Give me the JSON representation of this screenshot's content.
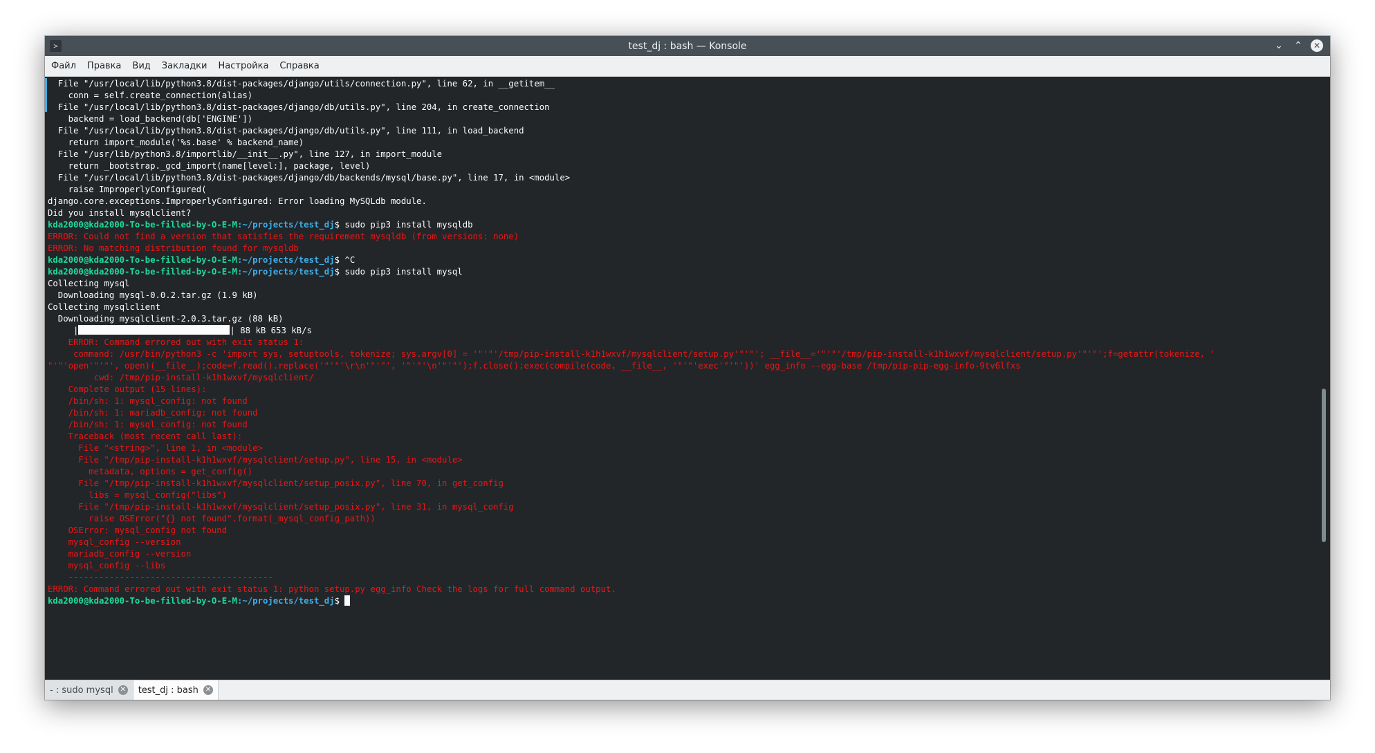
{
  "window": {
    "title": "test_dj : bash — Konsole",
    "app_icon": "terminal-icon",
    "controls": [
      "minimize-icon",
      "maximize-icon",
      "close-icon"
    ]
  },
  "menu": {
    "items": [
      "Файл",
      "Правка",
      "Вид",
      "Закладки",
      "Настройка",
      "Справка"
    ]
  },
  "terminal": {
    "prompt_user": "kda2000@kda2000-To-be-filled-by-O-E-M",
    "prompt_path": ":~/projects/test_dj",
    "lines": [
      {
        "text": "  File \"/usr/local/lib/python3.8/dist-packages/django/utils/connection.py\", line 62, in __getitem__",
        "type": "out"
      },
      {
        "text": "    conn = self.create_connection(alias)",
        "type": "out"
      },
      {
        "text": "  File \"/usr/local/lib/python3.8/dist-packages/django/db/utils.py\", line 204, in create_connection",
        "type": "out"
      },
      {
        "text": "    backend = load_backend(db['ENGINE'])",
        "type": "out"
      },
      {
        "text": "  File \"/usr/local/lib/python3.8/dist-packages/django/db/utils.py\", line 111, in load_backend",
        "type": "out"
      },
      {
        "text": "    return import_module('%s.base' % backend_name)",
        "type": "out"
      },
      {
        "text": "  File \"/usr/lib/python3.8/importlib/__init__.py\", line 127, in import_module",
        "type": "out"
      },
      {
        "text": "    return _bootstrap._gcd_import(name[level:], package, level)",
        "type": "out"
      },
      {
        "text": "  File \"/usr/local/lib/python3.8/dist-packages/django/db/backends/mysql/base.py\", line 17, in <module>",
        "type": "out"
      },
      {
        "text": "    raise ImproperlyConfigured(",
        "type": "out"
      },
      {
        "text": "django.core.exceptions.ImproperlyConfigured: Error loading MySQLdb module.",
        "type": "out"
      },
      {
        "text": "Did you install mysqlclient?",
        "type": "out"
      },
      {
        "text": " sudo pip3 install mysqldb",
        "type": "prompt"
      },
      {
        "text": "ERROR: Could not find a version that satisfies the requirement mysqldb (from versions: none)",
        "type": "err"
      },
      {
        "text": "ERROR: No matching distribution found for mysqldb",
        "type": "err"
      },
      {
        "text": " ^C",
        "type": "prompt"
      },
      {
        "text": " sudo pip3 install mysql",
        "type": "prompt"
      },
      {
        "text": "Collecting mysql",
        "type": "out"
      },
      {
        "text": "  Downloading mysql-0.0.2.tar.gz (1.9 kB)",
        "type": "out"
      },
      {
        "text": "Collecting mysqlclient",
        "type": "out"
      },
      {
        "text": "  Downloading mysqlclient-2.0.3.tar.gz (88 kB)",
        "type": "out"
      },
      {
        "text": "| 88 kB 653 kB/s",
        "type": "progress",
        "fill": 1.0
      },
      {
        "text": "    ERROR: Command errored out with exit status 1:",
        "type": "err"
      },
      {
        "text": "     command: /usr/bin/python3 -c 'import sys, setuptools, tokenize; sys.argv[0] = '\"'\"'/tmp/pip-install-k1h1wxvf/mysqlclient/setup.py'\"'\"'; __file__='\"'\"'/tmp/pip-install-k1h1wxvf/mysqlclient/setup.py'\"'\"';f=getattr(tokenize, '",
        "type": "err"
      },
      {
        "text": "\"'\"'open'\"'\"', open)(__file__);code=f.read().replace('\"'\"'\\r\\n'\"'\"', '\"'\"'\\n'\"'\"');f.close();exec(compile(code, __file__, '\"'\"'exec'\"'\"'))' egg_info --egg-base /tmp/pip-pip-egg-info-9tv6lfxs",
        "type": "err"
      },
      {
        "text": "         cwd: /tmp/pip-install-k1h1wxvf/mysqlclient/",
        "type": "err"
      },
      {
        "text": "    Complete output (15 lines):",
        "type": "err"
      },
      {
        "text": "    /bin/sh: 1: mysql_config: not found",
        "type": "err"
      },
      {
        "text": "    /bin/sh: 1: mariadb_config: not found",
        "type": "err"
      },
      {
        "text": "    /bin/sh: 1: mysql_config: not found",
        "type": "err"
      },
      {
        "text": "    Traceback (most recent call last):",
        "type": "err"
      },
      {
        "text": "      File \"<string>\", line 1, in <module>",
        "type": "err"
      },
      {
        "text": "      File \"/tmp/pip-install-k1h1wxvf/mysqlclient/setup.py\", line 15, in <module>",
        "type": "err"
      },
      {
        "text": "        metadata, options = get_config()",
        "type": "err"
      },
      {
        "text": "      File \"/tmp/pip-install-k1h1wxvf/mysqlclient/setup_posix.py\", line 70, in get_config",
        "type": "err"
      },
      {
        "text": "        libs = mysql_config(\"libs\")",
        "type": "err"
      },
      {
        "text": "      File \"/tmp/pip-install-k1h1wxvf/mysqlclient/setup_posix.py\", line 31, in mysql_config",
        "type": "err"
      },
      {
        "text": "        raise OSError(\"{} not found\".format(_mysql_config_path))",
        "type": "err"
      },
      {
        "text": "    OSError: mysql_config not found",
        "type": "err"
      },
      {
        "text": "    mysql_config --version",
        "type": "err"
      },
      {
        "text": "    mariadb_config --version",
        "type": "err"
      },
      {
        "text": "    mysql_config --libs",
        "type": "err"
      },
      {
        "text": "    ----------------------------------------",
        "type": "err"
      },
      {
        "text": "ERROR: Command errored out with exit status 1: python setup.py egg_info Check the logs for full command output.",
        "type": "err"
      },
      {
        "text": " ",
        "type": "prompt",
        "cursor": true
      }
    ]
  },
  "tabs": [
    {
      "label": "- : sudo mysql",
      "active": false
    },
    {
      "label": "test_dj : bash",
      "active": true
    }
  ],
  "colors": {
    "terminal_bg": "#232629",
    "text": "#fcfcfc",
    "error": "#ed1515",
    "prompt_user": "#1cdc9a",
    "prompt_path": "#3daee9"
  }
}
